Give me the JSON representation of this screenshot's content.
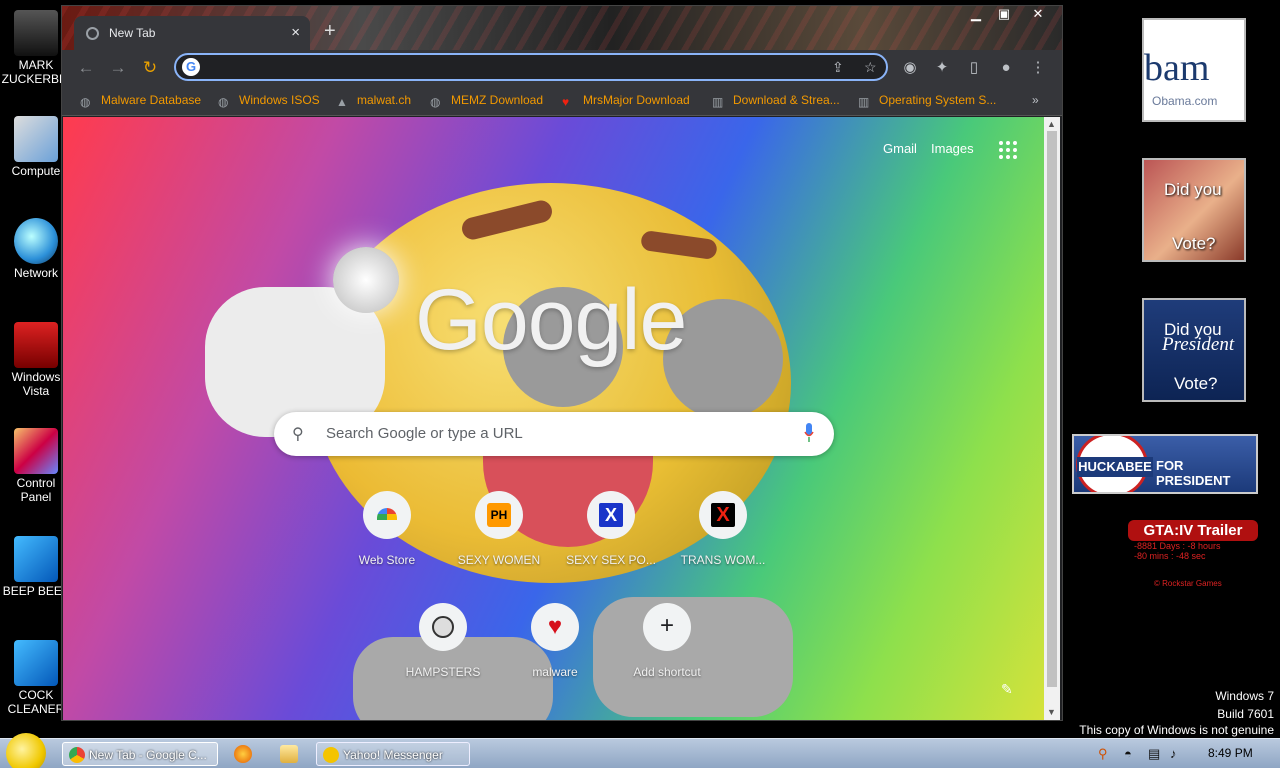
{
  "desktop": {
    "icons": [
      {
        "label": "MARK ZUCKERBEI",
        "icon": "user-folder-icon"
      },
      {
        "label": "Compute",
        "icon": "computer-icon"
      },
      {
        "label": "Network",
        "icon": "network-icon"
      },
      {
        "label": "Windows Vista",
        "icon": "recycle-bin-icon"
      },
      {
        "label": "Control Panel",
        "icon": "control-panel-icon"
      },
      {
        "label": "BEEP BEEF",
        "icon": "app-icon"
      },
      {
        "label": "COCK CLEANER",
        "icon": "app-icon"
      }
    ],
    "gadgets": {
      "obama_big": "bam",
      "obama_small": "Obama.com",
      "mccain_l1": "Did you",
      "mccain_l2": "Vote?",
      "pres_l1": "Did you",
      "pres_l2": "President",
      "pres_l3": "Vote?",
      "huck_badge": "HUCKABEE",
      "huck_pres": "FOR PRESIDENT",
      "gta_title": "GTA:IV Trailer",
      "gta_t1": "-8881 Days : -8 hours",
      "gta_t2": "-80 mins : -48 sec",
      "gta_t3": "© Rockstar Games"
    },
    "watermark": {
      "line1": "Windows 7",
      "line2": "Build 7601",
      "line3": "This copy of Windows is not genuine"
    }
  },
  "browser": {
    "tab_title": "New Tab",
    "omnibox_value": "",
    "bookmarks": [
      {
        "label": "Malware Database",
        "icon": "globe-icon"
      },
      {
        "label": "Windows ISOS",
        "icon": "globe-icon"
      },
      {
        "label": "malwat.ch",
        "icon": "site-icon"
      },
      {
        "label": "MEMZ Download",
        "icon": "globe-icon"
      },
      {
        "label": "MrsMajor Download",
        "icon": "heart-icon"
      },
      {
        "label": "Download & Strea...",
        "icon": "archive-icon"
      },
      {
        "label": "Operating System S...",
        "icon": "archive-icon"
      }
    ],
    "bookmarks_more": "»",
    "ntp": {
      "gmail": "Gmail",
      "images": "Images",
      "logo": "Google",
      "search_placeholder": "Search Google or type a URL",
      "shortcuts_row1": [
        {
          "label": "Web Store"
        },
        {
          "label": "SEXY WOMEN",
          "badge": "PH"
        },
        {
          "label": "SEXY SEX PO...",
          "badge": "X"
        },
        {
          "label": "TRANS WOM...",
          "badge": "X"
        }
      ],
      "shortcuts_row2": [
        {
          "label": "HAMPSTERS"
        },
        {
          "label": "malware"
        },
        {
          "label": "Add shortcut"
        }
      ]
    }
  },
  "taskbar": {
    "tasks": [
      {
        "label": "New Tab - Google C..."
      },
      {
        "label": "Yahoo! Messenger"
      }
    ],
    "clock": "8:49 PM"
  }
}
